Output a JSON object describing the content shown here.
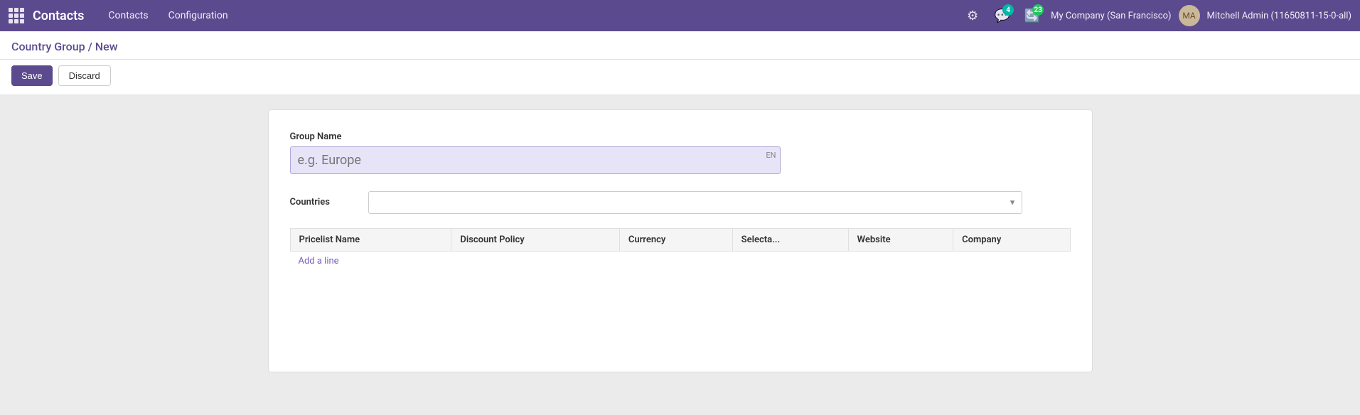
{
  "app": {
    "title": "Contacts"
  },
  "topnav": {
    "menu_items": [
      "Contacts",
      "Configuration"
    ],
    "company": "My Company (San Francisco)",
    "user": "Mitchell Admin (11650811-15-0-all)",
    "notifications_count": "4",
    "messages_count": "23"
  },
  "breadcrumb": {
    "text": "Country Group / New"
  },
  "actions": {
    "save_label": "Save",
    "discard_label": "Discard"
  },
  "form": {
    "group_name_label": "Group Name",
    "group_name_placeholder": "e.g. Europe",
    "lang_badge": "EN",
    "countries_label": "Countries",
    "countries_placeholder": "",
    "pricelist_table": {
      "columns": [
        "Pricelist Name",
        "Discount Policy",
        "Currency",
        "Selecta...",
        "Website",
        "Company"
      ],
      "rows": []
    },
    "add_line_label": "Add a line"
  }
}
